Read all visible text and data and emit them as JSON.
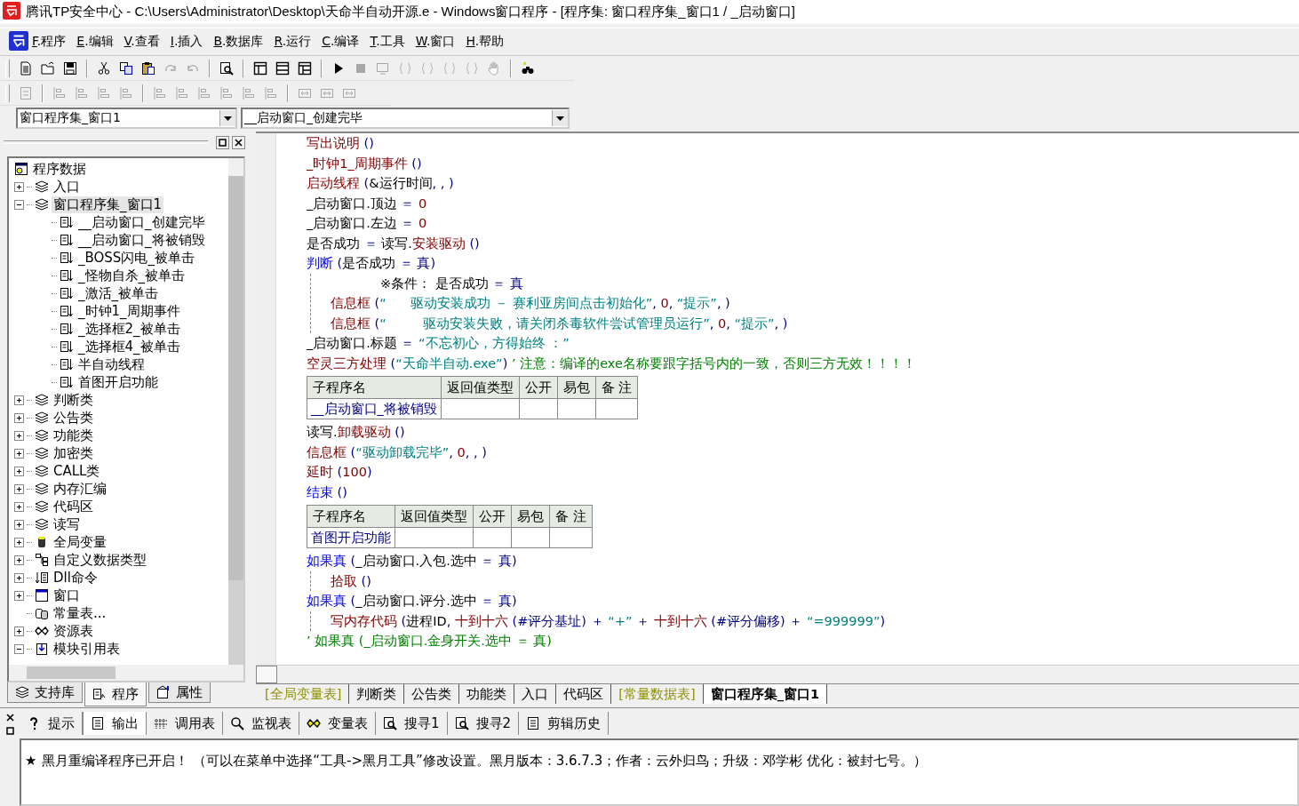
{
  "window": {
    "title": "腾讯TP安全中心 - C:\\Users\\Administrator\\Desktop\\天命半自动开源.e - Windows窗口程序 - [程序集: 窗口程序集_窗口1 / _启动窗口]"
  },
  "menu": [
    "F.程序",
    "E.编辑",
    "V.查看",
    "I.插入",
    "B.数据库",
    "R.运行",
    "C.编译",
    "T.工具",
    "W.窗口",
    "H.帮助"
  ],
  "toolbars": [
    [
      [
        {
          "kind": "new",
          "disabled": false
        },
        {
          "kind": "open",
          "disabled": false
        },
        {
          "kind": "save",
          "disabled": false
        }
      ],
      [
        {
          "kind": "cut",
          "disabled": false
        },
        {
          "kind": "copy",
          "disabled": false
        },
        {
          "kind": "paste",
          "disabled": false
        },
        {
          "kind": "redo",
          "disabled": true
        },
        {
          "kind": "undo",
          "disabled": true
        }
      ],
      [
        {
          "kind": "find",
          "disabled": false
        }
      ],
      [
        {
          "kind": "layout-a",
          "disabled": false
        },
        {
          "kind": "layout-b",
          "disabled": false
        },
        {
          "kind": "layout-c",
          "disabled": false
        }
      ],
      [
        {
          "kind": "run",
          "disabled": false
        },
        {
          "kind": "stop",
          "disabled": true
        },
        {
          "kind": "monitor",
          "disabled": true
        },
        {
          "kind": "brace",
          "disabled": true
        },
        {
          "kind": "brace",
          "disabled": true
        },
        {
          "kind": "brace",
          "disabled": true
        },
        {
          "kind": "brace",
          "disabled": true
        },
        {
          "kind": "hand",
          "disabled": true
        }
      ],
      [
        {
          "kind": "binoculars",
          "disabled": false
        }
      ]
    ],
    [
      [
        {
          "kind": "form",
          "disabled": true
        }
      ],
      [
        {
          "kind": "align",
          "disabled": true
        },
        {
          "kind": "align",
          "disabled": true
        },
        {
          "kind": "align",
          "disabled": true
        },
        {
          "kind": "align",
          "disabled": true
        }
      ],
      [
        {
          "kind": "align",
          "disabled": true
        },
        {
          "kind": "align",
          "disabled": true
        },
        {
          "kind": "align",
          "disabled": true
        },
        {
          "kind": "align",
          "disabled": true
        },
        {
          "kind": "align",
          "disabled": true
        },
        {
          "kind": "align",
          "disabled": true
        }
      ],
      [
        {
          "kind": "resize",
          "disabled": true
        },
        {
          "kind": "resize",
          "disabled": true
        },
        {
          "kind": "resize",
          "disabled": true
        }
      ]
    ]
  ],
  "selectors": [
    {
      "value": "窗口程序集_窗口1"
    },
    {
      "value": "__启动窗口_创建完毕"
    }
  ],
  "tree": {
    "label": "程序数据",
    "items": [
      {
        "label": "入口",
        "kind": "module",
        "expanded": false,
        "selected": false
      },
      {
        "label": "窗口程序集_窗口1",
        "kind": "module",
        "expanded": true,
        "selected": true,
        "children": [
          {
            "label": "__启动窗口_创建完毕",
            "kind": "method",
            "selected": false
          },
          {
            "label": "__启动窗口_将被销毁",
            "kind": "method",
            "selected": false
          },
          {
            "label": "_BOSS闪电_被单击",
            "kind": "method",
            "selected": false
          },
          {
            "label": "_怪物自杀_被单击",
            "kind": "method",
            "selected": false
          },
          {
            "label": "_激活_被单击",
            "kind": "method",
            "selected": false
          },
          {
            "label": "_时钟1_周期事件",
            "kind": "method",
            "selected": false
          },
          {
            "label": "_选择框2_被单击",
            "kind": "method",
            "selected": false
          },
          {
            "label": "_选择框4_被单击",
            "kind": "method",
            "selected": false
          },
          {
            "label": "半自动线程",
            "kind": "method",
            "selected": false
          },
          {
            "label": "首图开启功能",
            "kind": "method",
            "selected": false
          }
        ]
      },
      {
        "label": "判断类",
        "kind": "module",
        "expanded": false,
        "selected": false
      },
      {
        "label": "公告类",
        "kind": "module",
        "expanded": false,
        "selected": false
      },
      {
        "label": "功能类",
        "kind": "module",
        "expanded": false,
        "selected": false
      },
      {
        "label": "加密类",
        "kind": "module",
        "expanded": false,
        "selected": false
      },
      {
        "label": "CALL类",
        "kind": "module",
        "expanded": false,
        "selected": false
      },
      {
        "label": "内存汇编",
        "kind": "module",
        "expanded": false,
        "selected": false
      },
      {
        "label": "代码区",
        "kind": "module",
        "expanded": false,
        "selected": false
      },
      {
        "label": "读写",
        "kind": "module",
        "expanded": false,
        "selected": false
      },
      {
        "label": "全局变量",
        "kind": "globals",
        "expanded": false,
        "selected": false
      },
      {
        "label": "自定义数据类型",
        "kind": "datatype",
        "expanded": false,
        "selected": false
      },
      {
        "label": "Dll命令",
        "kind": "dll",
        "expanded": false,
        "selected": false
      },
      {
        "label": "窗口",
        "kind": "window",
        "expanded": false,
        "selected": false
      },
      {
        "label": "常量表...",
        "kind": "constants",
        "selected": false
      },
      {
        "label": "资源表",
        "kind": "resources",
        "expanded": false,
        "selected": false
      },
      {
        "label": "模块引用表",
        "kind": "modref",
        "expanded": true,
        "selected": false
      }
    ]
  },
  "panel_tabs": [
    {
      "label": "支持库",
      "kind": "library",
      "selected": false
    },
    {
      "label": "程序",
      "kind": "program",
      "selected": true
    },
    {
      "label": "属性",
      "kind": "properties",
      "selected": false
    }
  ],
  "code": [
    {
      "kind": "line",
      "segs": [
        {
          "t": "写出说明",
          "kind": "command"
        },
        {
          "t": " ()",
          "kind": "op"
        }
      ]
    },
    {
      "kind": "line",
      "segs": [
        {
          "t": "_时钟1_周期事件",
          "kind": "command"
        },
        {
          "t": " ()",
          "kind": "op"
        }
      ]
    },
    {
      "kind": "line",
      "segs": [
        {
          "t": "启动线程",
          "kind": "command"
        },
        {
          "t": " (",
          "kind": "op"
        },
        {
          "t": "&运行时间",
          "kind": "text"
        },
        {
          "t": ", , )",
          "kind": "op"
        }
      ]
    },
    {
      "kind": "line",
      "segs": [
        {
          "t": "_启动窗口.顶边",
          "kind": "text"
        },
        {
          "t": " ＝ ",
          "kind": "op"
        },
        {
          "t": "0",
          "kind": "number"
        }
      ]
    },
    {
      "kind": "line",
      "segs": [
        {
          "t": "_启动窗口.左边",
          "kind": "text"
        },
        {
          "t": " ＝ ",
          "kind": "op"
        },
        {
          "t": "0",
          "kind": "number"
        }
      ]
    },
    {
      "kind": "line",
      "segs": [
        {
          "t": "是否成功",
          "kind": "text"
        },
        {
          "t": " ＝ ",
          "kind": "op"
        },
        {
          "t": "读写.",
          "kind": "text"
        },
        {
          "t": "安装驱动",
          "kind": "command"
        },
        {
          "t": " ()",
          "kind": "op"
        }
      ]
    },
    {
      "kind": "line",
      "segs": [
        {
          "t": "判断",
          "kind": "keyword"
        },
        {
          "t": " (",
          "kind": "op"
        },
        {
          "t": "是否成功",
          "kind": "text"
        },
        {
          "t": " ＝ 真)",
          "kind": "op"
        }
      ],
      "children": [
        {
          "kind": "note",
          "segs": [
            {
              "t": "※条件： 是否成功",
              "kind": "text"
            },
            {
              "t": " ＝ 真",
              "kind": "op"
            }
          ]
        },
        {
          "kind": "line",
          "segs": [
            {
              "t": "信息框",
              "kind": "command"
            },
            {
              "t": " (",
              "kind": "op"
            },
            {
              "t": "“      驱动安装成功 － 赛利亚房间点击初始化”",
              "kind": "string"
            },
            {
              "t": ", ",
              "kind": "op"
            },
            {
              "t": "0",
              "kind": "number"
            },
            {
              "t": ", ",
              "kind": "op"
            },
            {
              "t": "“提示”",
              "kind": "string"
            },
            {
              "t": ", )",
              "kind": "op"
            }
          ]
        },
        {
          "kind": "line",
          "segs": [
            {
              "t": "信息框",
              "kind": "command"
            },
            {
              "t": " (",
              "kind": "op"
            },
            {
              "t": "“         驱动安装失败，请关闭杀毒软件尝试管理员运行”",
              "kind": "string"
            },
            {
              "t": ", ",
              "kind": "op"
            },
            {
              "t": "0",
              "kind": "number"
            },
            {
              "t": ", ",
              "kind": "op"
            },
            {
              "t": "“提示”",
              "kind": "string"
            },
            {
              "t": ", )",
              "kind": "op"
            }
          ]
        }
      ]
    },
    {
      "kind": "line",
      "segs": [
        {
          "t": "_启动窗口.标题",
          "kind": "text"
        },
        {
          "t": " ＝ ",
          "kind": "op"
        },
        {
          "t": "“不忘初心，方得始终 ：”",
          "kind": "string"
        }
      ]
    },
    {
      "kind": "line",
      "segs": [
        {
          "t": "空灵三方处理",
          "kind": "command"
        },
        {
          "t": " (",
          "kind": "op"
        },
        {
          "t": "“天命半自动.exe”",
          "kind": "string"
        },
        {
          "t": ") ",
          "kind": "op"
        },
        {
          "t": "’ 注意：编译的exe名称要跟字括号内的一致，否则三方无效！！！！",
          "kind": "comment"
        }
      ]
    },
    {
      "kind": "table",
      "columns": [
        "子程序名",
        "返回值类型",
        "公开",
        "易包",
        "备 注"
      ],
      "name": "__启动窗口_将被销毁"
    },
    {
      "kind": "line",
      "segs": [
        {
          "t": "读写.",
          "kind": "text"
        },
        {
          "t": "卸载驱动",
          "kind": "command"
        },
        {
          "t": " ()",
          "kind": "op"
        }
      ]
    },
    {
      "kind": "line",
      "segs": [
        {
          "t": "信息框",
          "kind": "command"
        },
        {
          "t": " (",
          "kind": "op"
        },
        {
          "t": "“驱动卸载完毕”",
          "kind": "string"
        },
        {
          "t": ", ",
          "kind": "op"
        },
        {
          "t": "0",
          "kind": "number"
        },
        {
          "t": ", , )",
          "kind": "op"
        }
      ]
    },
    {
      "kind": "line",
      "segs": [
        {
          "t": "延时",
          "kind": "command"
        },
        {
          "t": " (",
          "kind": "op"
        },
        {
          "t": "100",
          "kind": "number"
        },
        {
          "t": ")",
          "kind": "op"
        }
      ]
    },
    {
      "kind": "line",
      "segs": [
        {
          "t": "结束",
          "kind": "keyword"
        },
        {
          "t": " ()",
          "kind": "op"
        }
      ]
    },
    {
      "kind": "table",
      "columns": [
        "子程序名",
        "返回值类型",
        "公开",
        "易包",
        "备 注"
      ],
      "name": "首图开启功能"
    },
    {
      "kind": "line",
      "segs": [
        {
          "t": "如果真",
          "kind": "keyword"
        },
        {
          "t": " (",
          "kind": "op"
        },
        {
          "t": "_启动窗口.入包.选中",
          "kind": "text"
        },
        {
          "t": " ＝ 真)",
          "kind": "op"
        }
      ],
      "children": [
        {
          "kind": "line",
          "segs": [
            {
              "t": "拾取",
              "kind": "command"
            },
            {
              "t": " ()",
              "kind": "op"
            }
          ]
        }
      ]
    },
    {
      "kind": "line",
      "segs": [
        {
          "t": "如果真",
          "kind": "keyword"
        },
        {
          "t": " (",
          "kind": "op"
        },
        {
          "t": "_启动窗口.评分.选中",
          "kind": "text"
        },
        {
          "t": " ＝ 真)",
          "kind": "op"
        }
      ],
      "children": [
        {
          "kind": "line",
          "segs": [
            {
              "t": "写内存代码",
              "kind": "command"
            },
            {
              "t": " (",
              "kind": "op"
            },
            {
              "t": "进程ID",
              "kind": "text"
            },
            {
              "t": ", ",
              "kind": "op"
            },
            {
              "t": "十到十六",
              "kind": "command"
            },
            {
              "t": " (#评分基址) ＋ ",
              "kind": "op"
            },
            {
              "t": "“+”",
              "kind": "string"
            },
            {
              "t": " ＋ ",
              "kind": "op"
            },
            {
              "t": "十到十六",
              "kind": "command"
            },
            {
              "t": " (#评分偏移) ＋ ",
              "kind": "op"
            },
            {
              "t": "“=999999”",
              "kind": "string"
            },
            {
              "t": ")",
              "kind": "op"
            }
          ]
        }
      ]
    },
    {
      "kind": "line",
      "segs": [
        {
          "t": "’ 如果真 (_启动窗口.金身开关.选中 ＝ 真)",
          "kind": "comment"
        }
      ]
    }
  ],
  "code_tabs": [
    {
      "label": "[全局变量表]",
      "kind": "table",
      "selected": false
    },
    {
      "label": "判断类",
      "kind": "class",
      "selected": false
    },
    {
      "label": "公告类",
      "kind": "class",
      "selected": false
    },
    {
      "label": "功能类",
      "kind": "class",
      "selected": false
    },
    {
      "label": "入口",
      "kind": "class",
      "selected": false
    },
    {
      "label": "代码区",
      "kind": "class",
      "selected": false
    },
    {
      "label": "[常量数据表]",
      "kind": "table",
      "selected": false
    },
    {
      "label": "窗口程序集_窗口1",
      "kind": "class",
      "selected": true
    }
  ],
  "output_tabs": [
    {
      "label": "提示",
      "kind": "hint",
      "selected": false
    },
    {
      "label": "输出",
      "kind": "output",
      "selected": true
    },
    {
      "label": "调用表",
      "kind": "calls",
      "selected": false
    },
    {
      "label": "监视表",
      "kind": "watch",
      "selected": false
    },
    {
      "label": "变量表",
      "kind": "vars",
      "selected": false
    },
    {
      "label": "搜寻1",
      "kind": "search",
      "selected": false
    },
    {
      "label": "搜寻2",
      "kind": "search",
      "selected": false
    },
    {
      "label": "剪辑历史",
      "kind": "clips",
      "selected": false
    }
  ],
  "output": {
    "marker": "★",
    "message": "黑月重编译程序已开启！ （可以在菜单中选择“工具->黑月工具”修改设置。黑月版本：3.6.7.3；作者：云外归鸟；升级：邓学彬 优化：被封七号。）"
  }
}
